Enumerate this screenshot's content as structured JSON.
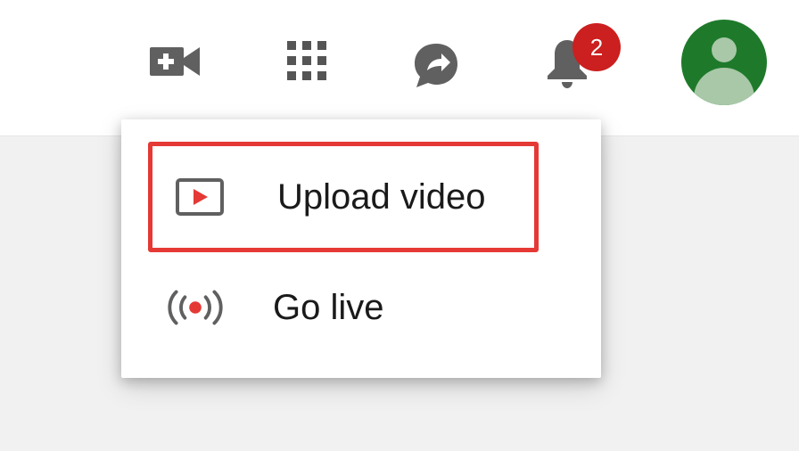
{
  "header": {
    "icons": {
      "create": "video-camera-plus-icon",
      "apps": "apps-grid-icon",
      "messages": "chat-bubble-icon",
      "notifications": "bell-icon",
      "account": "account-avatar-icon"
    },
    "notifications_count": "2"
  },
  "menu": {
    "items": [
      {
        "label": "Upload video",
        "icon": "upload-video-icon",
        "highlighted": true
      },
      {
        "label": "Go live",
        "icon": "live-broadcast-icon",
        "highlighted": false
      }
    ]
  },
  "colors": {
    "accent_red": "#e53935",
    "badge_red": "#cc1f1f",
    "avatar_green": "#1e7a2a",
    "icon_gray": "#606060"
  }
}
